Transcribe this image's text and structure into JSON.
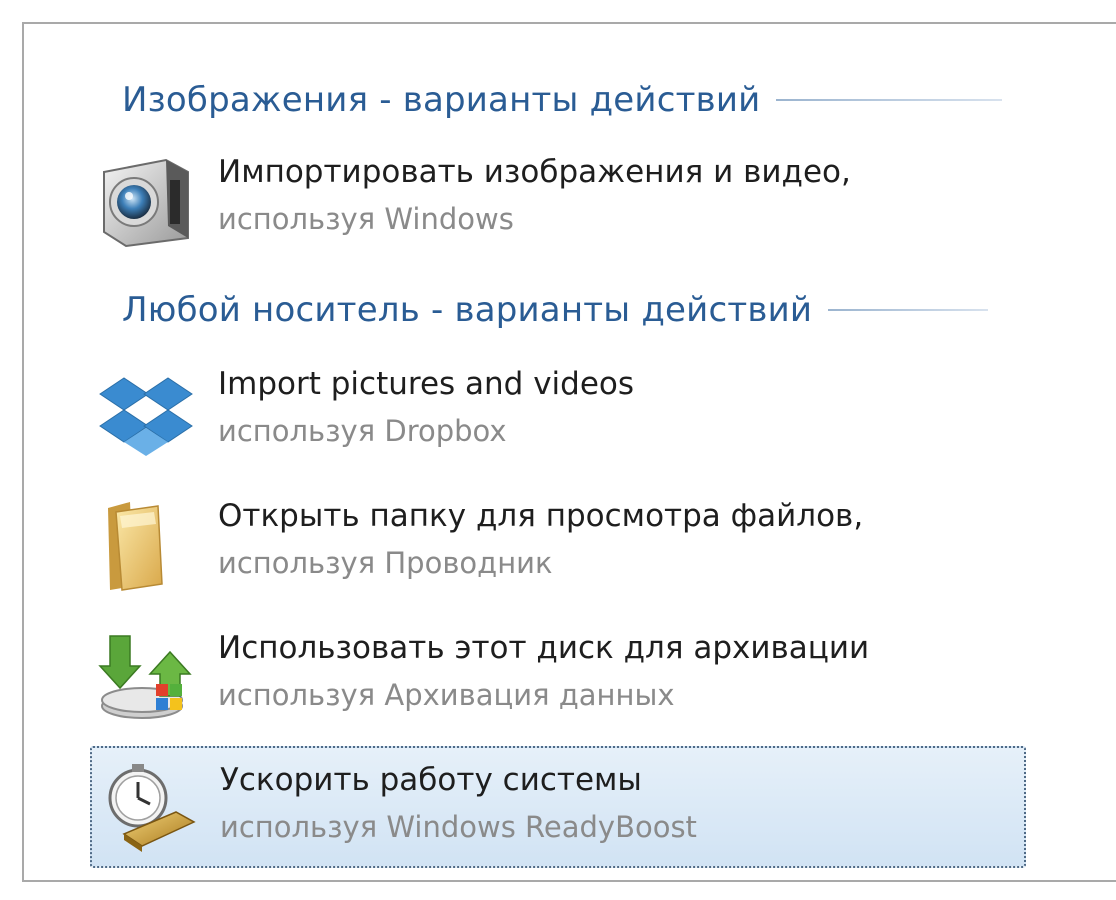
{
  "groups": [
    {
      "title": "Изображения - варианты действий",
      "items": [
        {
          "primary": "Импортировать изображения и видео,",
          "secondary": "используя Windows",
          "icon": "camera-icon"
        }
      ]
    },
    {
      "title": "Любой носитель - варианты действий",
      "items": [
        {
          "primary": "Import pictures and videos",
          "secondary": "используя Dropbox",
          "icon": "dropbox-icon"
        },
        {
          "primary": "Открыть папку для просмотра файлов,",
          "secondary": "используя Проводник",
          "icon": "folder-icon"
        },
        {
          "primary": "Использовать этот диск для архивации",
          "secondary": "используя Архивация данных",
          "icon": "backup-icon"
        },
        {
          "primary": "Ускорить работу системы",
          "secondary": "используя Windows ReadyBoost",
          "icon": "readyboost-icon",
          "selected": true
        }
      ]
    }
  ],
  "colors": {
    "header": "#2a5c94",
    "primary_text": "#1e1e1e",
    "secondary_text": "#8a8a8a",
    "selection_border": "#4f6a86",
    "selection_fill": "#d1e3f4"
  }
}
